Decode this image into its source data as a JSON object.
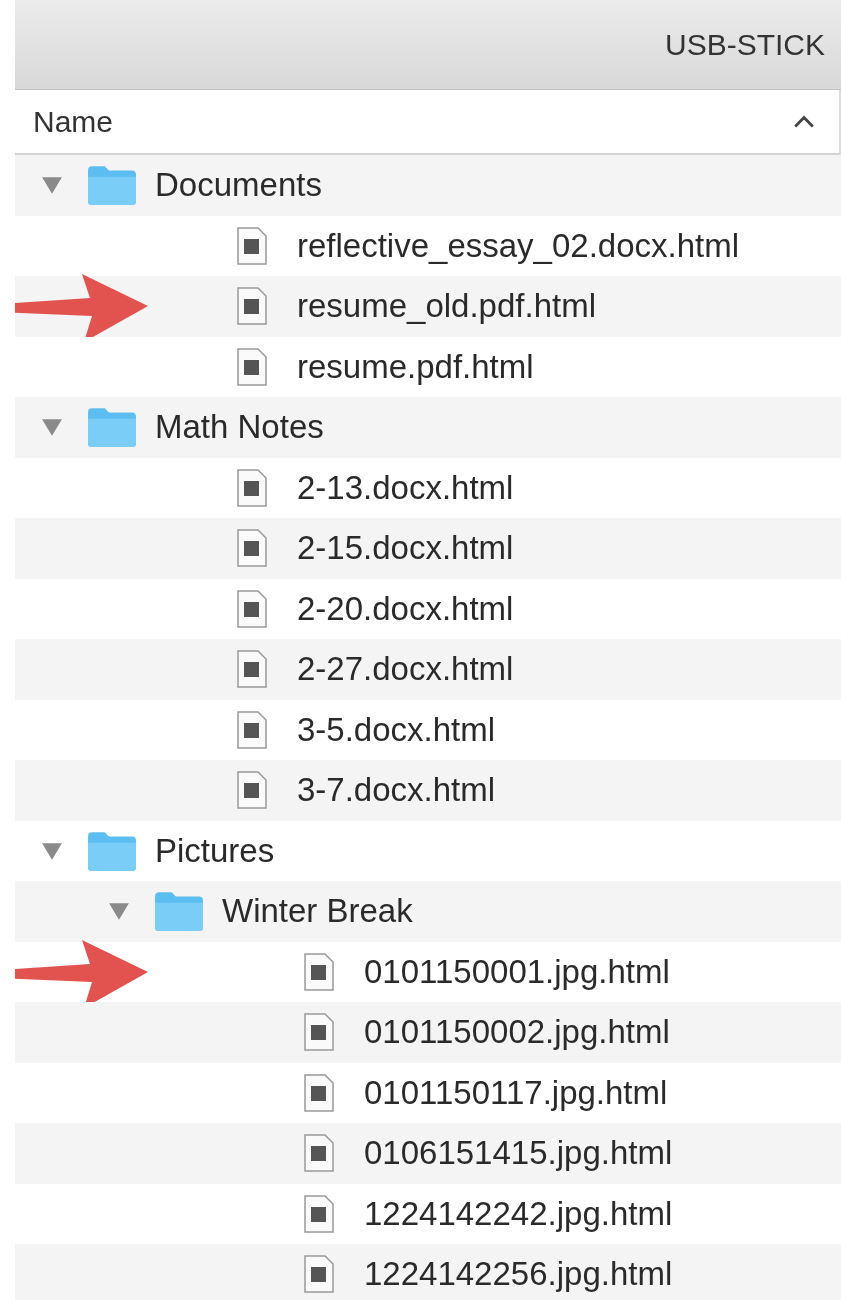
{
  "window": {
    "title": "USB-STICK"
  },
  "header": {
    "label": "Name"
  },
  "tree": [
    {
      "name": "Documents",
      "kind": "folder",
      "expanded": true,
      "marked": false,
      "children": [
        {
          "name": "reflective_essay_02.docx.html",
          "kind": "file",
          "marked": false
        },
        {
          "name": "resume_old.pdf.html",
          "kind": "file",
          "marked": true
        },
        {
          "name": "resume.pdf.html",
          "kind": "file",
          "marked": false
        }
      ]
    },
    {
      "name": "Math Notes",
      "kind": "folder",
      "expanded": true,
      "marked": false,
      "children": [
        {
          "name": "2-13.docx.html",
          "kind": "file",
          "marked": false
        },
        {
          "name": "2-15.docx.html",
          "kind": "file",
          "marked": false
        },
        {
          "name": "2-20.docx.html",
          "kind": "file",
          "marked": false
        },
        {
          "name": "2-27.docx.html",
          "kind": "file",
          "marked": false
        },
        {
          "name": "3-5.docx.html",
          "kind": "file",
          "marked": false
        },
        {
          "name": "3-7.docx.html",
          "kind": "file",
          "marked": false
        }
      ]
    },
    {
      "name": "Pictures",
      "kind": "folder",
      "expanded": true,
      "marked": false,
      "children": [
        {
          "name": "Winter Break",
          "kind": "folder",
          "expanded": true,
          "marked": false,
          "children": [
            {
              "name": "0101150001.jpg.html",
              "kind": "file",
              "marked": true
            },
            {
              "name": "0101150002.jpg.html",
              "kind": "file",
              "marked": false
            },
            {
              "name": "0101150117.jpg.html",
              "kind": "file",
              "marked": false
            },
            {
              "name": "0106151415.jpg.html",
              "kind": "file",
              "marked": false
            },
            {
              "name": "1224142242.jpg.html",
              "kind": "file",
              "marked": false
            },
            {
              "name": "1224142256.jpg.html",
              "kind": "file",
              "marked": false
            }
          ]
        }
      ]
    }
  ]
}
